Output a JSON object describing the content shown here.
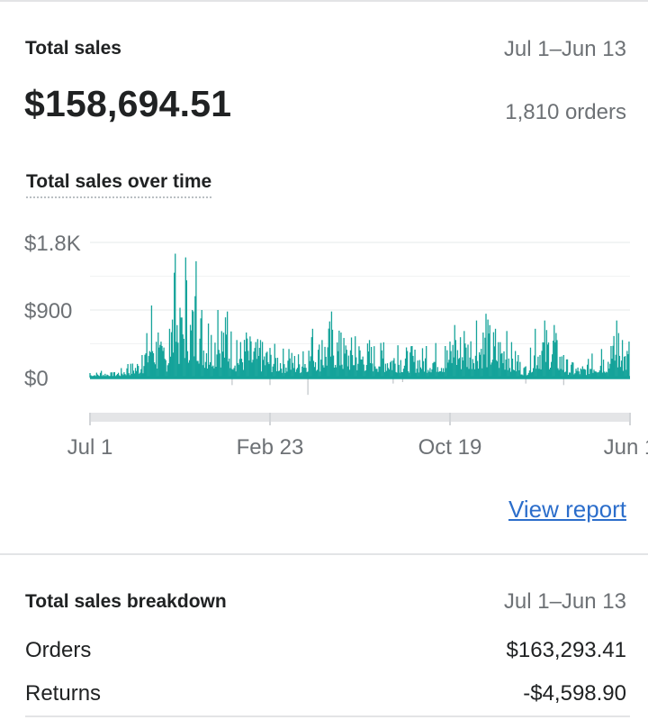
{
  "summary": {
    "title": "Total sales",
    "date_range": "Jul 1–Jun 13",
    "amount": "$158,694.51",
    "orders": "1,810 orders"
  },
  "chart_data": {
    "type": "bar",
    "title": "Total sales over time",
    "y_ticks": [
      "$1.8K",
      "$900",
      "$0"
    ],
    "x_ticks": [
      "Jul 1",
      "Feb 23",
      "Oct 19",
      "Jun 1"
    ],
    "ylim": [
      -250,
      1800
    ],
    "grid": true,
    "color": "#15a39a",
    "baseline_color": "#bfc4c8",
    "peaks": [
      {
        "day": 0,
        "value": 60
      },
      {
        "day": 12,
        "value": 90
      },
      {
        "day": 25,
        "value": 70
      },
      {
        "day": 40,
        "value": 180
      },
      {
        "day": 55,
        "value": 300
      },
      {
        "day": 65,
        "value": 960
      },
      {
        "day": 72,
        "value": 600
      },
      {
        "day": 78,
        "value": 400
      },
      {
        "day": 84,
        "value": 650
      },
      {
        "day": 90,
        "value": 1650
      },
      {
        "day": 96,
        "value": 800
      },
      {
        "day": 101,
        "value": 1600
      },
      {
        "day": 108,
        "value": 900
      },
      {
        "day": 112,
        "value": 1550
      },
      {
        "day": 118,
        "value": 900
      },
      {
        "day": 125,
        "value": 720
      },
      {
        "day": 135,
        "value": 900
      },
      {
        "day": 145,
        "value": 880
      },
      {
        "day": 155,
        "value": 500
      },
      {
        "day": 165,
        "value": 600
      },
      {
        "day": 180,
        "value": 500
      },
      {
        "day": 195,
        "value": 450
      },
      {
        "day": 210,
        "value": 380
      },
      {
        "day": 225,
        "value": 350
      },
      {
        "day": 235,
        "value": 650
      },
      {
        "day": 245,
        "value": 500
      },
      {
        "day": 255,
        "value": 880
      },
      {
        "day": 265,
        "value": 600
      },
      {
        "day": 280,
        "value": 550
      },
      {
        "day": 295,
        "value": 500
      },
      {
        "day": 310,
        "value": 470
      },
      {
        "day": 325,
        "value": 430
      },
      {
        "day": 340,
        "value": 420
      },
      {
        "day": 355,
        "value": 420
      },
      {
        "day": 365,
        "value": 460
      },
      {
        "day": 375,
        "value": 420
      },
      {
        "day": 385,
        "value": 700
      },
      {
        "day": 395,
        "value": 620
      },
      {
        "day": 408,
        "value": 760
      },
      {
        "day": 418,
        "value": 850
      },
      {
        "day": 428,
        "value": 650
      },
      {
        "day": 440,
        "value": 620
      },
      {
        "day": 452,
        "value": 300
      },
      {
        "day": 460,
        "value": 150
      },
      {
        "day": 470,
        "value": 650
      },
      {
        "day": 480,
        "value": 760
      },
      {
        "day": 490,
        "value": 700
      },
      {
        "day": 500,
        "value": 300
      },
      {
        "day": 510,
        "value": 200
      },
      {
        "day": 520,
        "value": 150
      },
      {
        "day": 530,
        "value": 320
      },
      {
        "day": 540,
        "value": 380
      },
      {
        "day": 550,
        "value": 420
      },
      {
        "day": 556,
        "value": 760
      },
      {
        "day": 562,
        "value": 500
      },
      {
        "day": 569,
        "value": 480
      }
    ],
    "dips": [
      {
        "day": 150,
        "value": -100
      },
      {
        "day": 190,
        "value": -100
      },
      {
        "day": 230,
        "value": -230
      },
      {
        "day": 320,
        "value": -80
      },
      {
        "day": 330,
        "value": -60
      },
      {
        "day": 460,
        "value": -80
      },
      {
        "day": 500,
        "value": -100
      }
    ]
  },
  "actions": {
    "view_report": "View report"
  },
  "breakdown": {
    "title": "Total sales breakdown",
    "date_range": "Jul 1–Jun 13",
    "rows": [
      {
        "label": "Orders",
        "value": "$163,293.41"
      },
      {
        "label": "Returns",
        "value": "-$4,598.90"
      }
    ]
  }
}
